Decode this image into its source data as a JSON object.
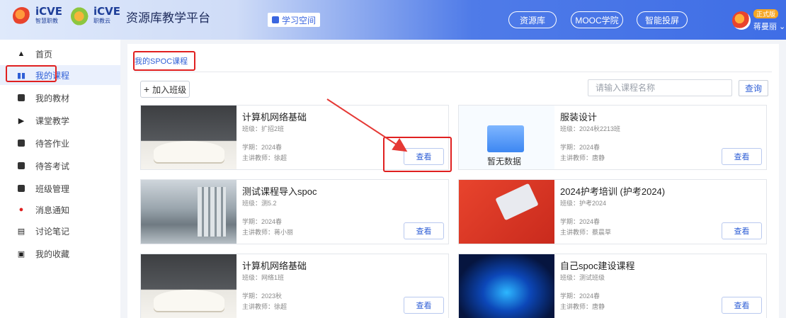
{
  "header": {
    "logo1_text": "iCVE",
    "logo1_sub": "智慧职教",
    "logo2_text": "iCVE",
    "logo2_sub": "职教云",
    "platform_title": "资源库教学平台",
    "study_space": "学习空间",
    "nav": [
      "资源库",
      "MOOC学院",
      "智能投屏"
    ],
    "user_badge": "正式版",
    "user_name": "蒋曼丽"
  },
  "sidebar": {
    "items": [
      {
        "label": "首页",
        "icon": "home-icon"
      },
      {
        "label": "我的课程",
        "icon": "books-icon",
        "active": true
      },
      {
        "label": "我的教材",
        "icon": "textbook-icon"
      },
      {
        "label": "课堂教学",
        "icon": "classroom-icon"
      },
      {
        "label": "待答作业",
        "icon": "homework-icon"
      },
      {
        "label": "待答考试",
        "icon": "exam-icon"
      },
      {
        "label": "班级管理",
        "icon": "class-icon"
      },
      {
        "label": "消息通知",
        "icon": "notification-icon"
      },
      {
        "label": "讨论笔记",
        "icon": "notes-icon"
      },
      {
        "label": "我的收藏",
        "icon": "favorites-icon"
      }
    ]
  },
  "main": {
    "tab_label": "我的SPOC课程",
    "join_label": "加入班级",
    "search_placeholder": "请输入课程名称",
    "search_label": "查询",
    "view_label": "查看",
    "no_data": "暂无数据",
    "courses": [
      {
        "title": "计算机网络基础",
        "class": "班级：扩招2班",
        "term": "学期：2024春",
        "teacher": "主讲教师：徐超",
        "thumb": "open-book"
      },
      {
        "title": "服装设计",
        "class": "班级：2024秋2213班",
        "term": "学期：2024春",
        "teacher": "主讲教师：唐静",
        "thumb": "empty-box"
      },
      {
        "title": "测试课程导入spoc",
        "class": "班级：测5.2",
        "term": "学期：2024春",
        "teacher": "主讲教师：蒋小丽",
        "thumb": "city"
      },
      {
        "title": "2024护考培训 (护考2024)",
        "class": "班级：护考2024",
        "term": "学期：2024春",
        "teacher": "主讲教师：蔡晨草",
        "thumb": "laptop"
      },
      {
        "title": "计算机网络基础",
        "class": "班级：网络1班",
        "term": "学期：2023秋",
        "teacher": "主讲教师：徐超",
        "thumb": "open-book"
      },
      {
        "title": "自己spoc建设课程",
        "class": "班级：测试班级",
        "term": "学期：2024春",
        "teacher": "主讲教师：唐静",
        "thumb": "tech"
      }
    ]
  },
  "colors": {
    "accent": "#2f5fd6",
    "highlight": "#e02020"
  }
}
